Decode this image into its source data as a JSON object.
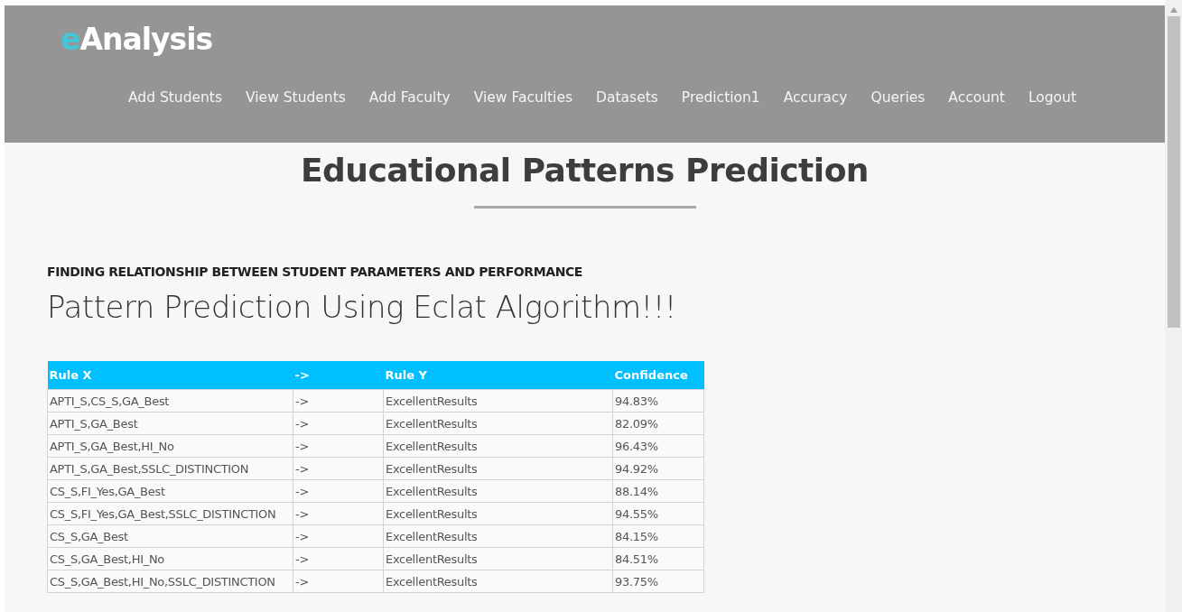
{
  "header": {
    "logo": {
      "accent": "e",
      "text": "Analysis"
    },
    "nav": [
      {
        "label": "Add Students"
      },
      {
        "label": "View Students"
      },
      {
        "label": "Add Faculty"
      },
      {
        "label": "View Faculties"
      },
      {
        "label": "Datasets"
      },
      {
        "label": "Prediction1"
      },
      {
        "label": "Accuracy"
      },
      {
        "label": "Queries"
      },
      {
        "label": "Account"
      },
      {
        "label": "Logout"
      }
    ]
  },
  "page_title": "Educational Patterns Prediction",
  "subtitle": "FINDING RELATIONSHIP BETWEEN STUDENT PARAMETERS AND PERFORMANCE",
  "heading": "Pattern Prediction Using Eclat Algorithm!!!",
  "table": {
    "columns": [
      "Rule X",
      "->",
      "Rule Y",
      "Confidence"
    ],
    "rows": [
      [
        "APTI_S,CS_S,GA_Best",
        "->",
        "ExcellentResults",
        "94.83%"
      ],
      [
        "APTI_S,GA_Best",
        "->",
        "ExcellentResults",
        "82.09%"
      ],
      [
        "APTI_S,GA_Best,HI_No",
        "->",
        "ExcellentResults",
        "96.43%"
      ],
      [
        "APTI_S,GA_Best,SSLC_DISTINCTION",
        "->",
        "ExcellentResults",
        "94.92%"
      ],
      [
        "CS_S,FI_Yes,GA_Best",
        "->",
        "ExcellentResults",
        "88.14%"
      ],
      [
        "CS_S,FI_Yes,GA_Best,SSLC_DISTINCTION",
        "->",
        "ExcellentResults",
        "94.55%"
      ],
      [
        "CS_S,GA_Best",
        "->",
        "ExcellentResults",
        "84.15%"
      ],
      [
        "CS_S,GA_Best,HI_No",
        "->",
        "ExcellentResults",
        "84.51%"
      ],
      [
        "CS_S,GA_Best,HI_No,SSLC_DISTINCTION",
        "->",
        "ExcellentResults",
        "93.75%"
      ]
    ]
  }
}
